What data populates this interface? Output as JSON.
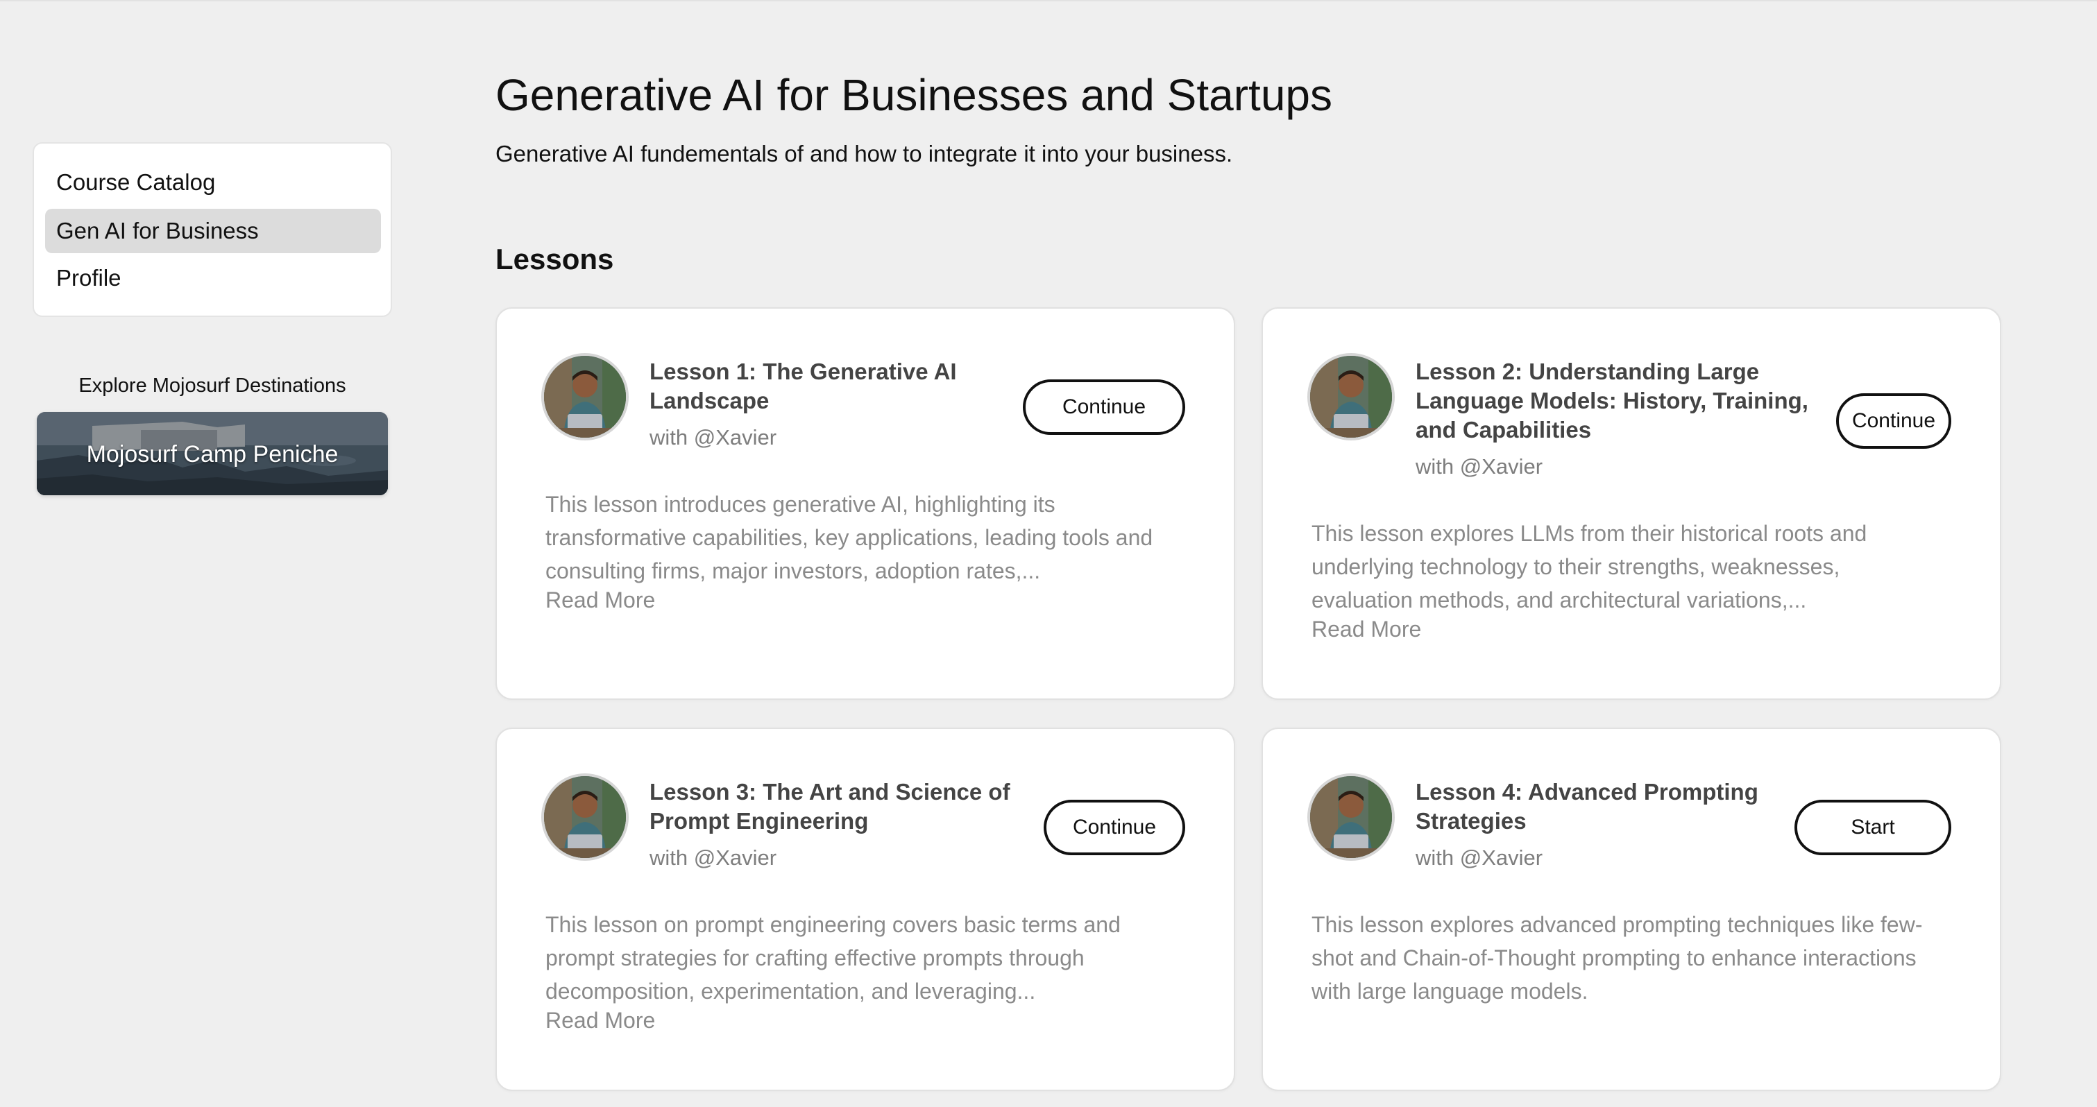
{
  "sidebar": {
    "items": [
      {
        "label": "Course Catalog",
        "active": false
      },
      {
        "label": "Gen AI for Business",
        "active": true
      },
      {
        "label": "Profile",
        "active": false
      }
    ],
    "explore_title": "Explore Mojosurf Destinations",
    "destination_label": "Mojosurf Camp Peniche"
  },
  "main": {
    "title": "Generative AI for Businesses and Startups",
    "subtitle": "Generative AI fundementals of and how to integrate it into your business.",
    "lessons_heading": "Lessons",
    "lessons": [
      {
        "title": "Lesson 1: The Generative AI Landscape",
        "author": "with @Xavier",
        "description": "This lesson introduces generative AI, highlighting its transformative capabilities, key applications, leading tools and consulting firms, major investors, adoption rates,...",
        "read_more": "Read More",
        "action": "Continue"
      },
      {
        "title": "Lesson 2: Understanding Large Language Models: History, Training, and Capabilities",
        "author": "with @Xavier",
        "description": "This lesson explores LLMs from their historical roots and underlying technology to their strengths, weaknesses, evaluation methods, and architectural variations,...",
        "read_more": "Read More",
        "action": "Continue"
      },
      {
        "title": "Lesson 3: The Art and Science of Prompt Engineering",
        "author": "with @Xavier",
        "description": "This lesson on prompt engineering covers basic terms and prompt strategies for crafting effective prompts through decomposition, experimentation, and leveraging...",
        "read_more": "Read More",
        "action": "Continue"
      },
      {
        "title": "Lesson 4: Advanced Prompting Strategies",
        "author": "with @Xavier",
        "description": "This lesson explores advanced prompting techniques like few-shot and Chain-of-Thought prompting to enhance interactions with large language models.",
        "action": "Start"
      }
    ]
  }
}
